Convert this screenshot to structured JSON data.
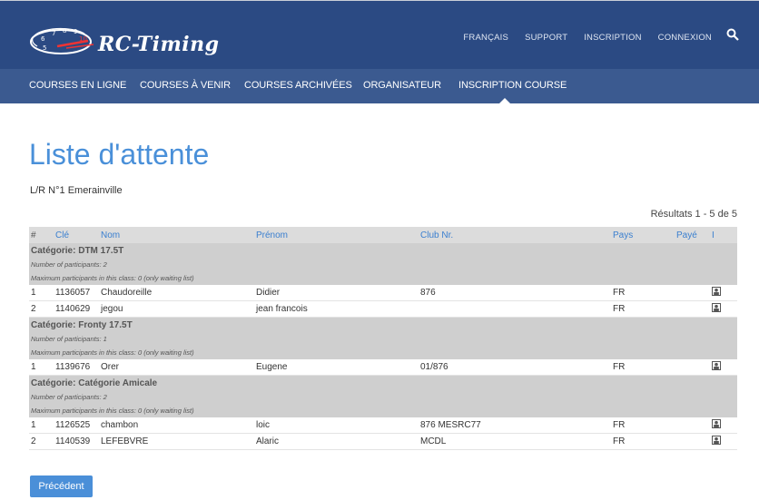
{
  "header": {
    "brand": "RC-Timing",
    "links": [
      "FRANÇAIS",
      "SUPPORT",
      "INSCRIPTION",
      "CONNEXION"
    ]
  },
  "nav": {
    "items": [
      "COURSES EN LIGNE",
      "COURSES À VENIR",
      "COURSES ARCHIVÉES",
      "ORGANISATEUR",
      "INSCRIPTION COURSE"
    ],
    "active": "INSCRIPTION COURSE"
  },
  "page": {
    "title": "Liste d'attente",
    "subtitle": "L/R N°1 Emerainville",
    "results": "Résultats 1 - 5 de 5",
    "prev_button": "Précédent"
  },
  "table": {
    "headers": [
      "#",
      "Clé",
      "Nom",
      "Prénom",
      "Club Nr.",
      "Pays",
      "Payé",
      "I"
    ],
    "categories": [
      {
        "name": "Catégorie: DTM 17.5T",
        "participants": "Number of participants: 2",
        "max": "Maximum participants in this class: 0 (only waiting list)",
        "rows": [
          {
            "n": "1",
            "key": "1136057",
            "nom": "Chaudoreille",
            "prenom": "Didier",
            "club": "876",
            "pays": "FR"
          },
          {
            "n": "2",
            "key": "1140629",
            "nom": "jegou",
            "prenom": "jean francois",
            "club": "",
            "pays": "FR"
          }
        ]
      },
      {
        "name": "Catégorie: Fronty 17.5T",
        "participants": "Number of participants: 1",
        "max": "Maximum participants in this class: 0 (only waiting list)",
        "rows": [
          {
            "n": "1",
            "key": "1139676",
            "nom": "Orer",
            "prenom": "Eugene",
            "club": "01/876",
            "pays": "FR"
          }
        ]
      },
      {
        "name": "Catégorie: Catégorie Amicale",
        "participants": "Number of participants: 2",
        "max": "Maximum participants in this class: 0 (only waiting list)",
        "rows": [
          {
            "n": "1",
            "key": "1126525",
            "nom": "chambon",
            "prenom": "loic",
            "club": "876 MESRC77",
            "pays": "FR"
          },
          {
            "n": "2",
            "key": "1140539",
            "nom": "LEFEBVRE",
            "prenom": "Alaric",
            "club": "MCDL",
            "pays": "FR"
          }
        ]
      }
    ]
  },
  "colors": {
    "header_bg": "#2b4a83",
    "nav_bg": "#3b5a90",
    "accent": "#4a90d9"
  }
}
